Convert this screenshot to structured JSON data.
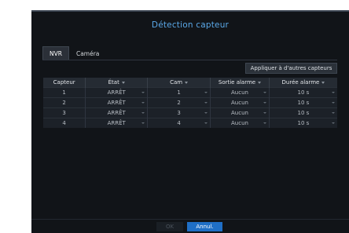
{
  "dialog": {
    "title": "Détection capteur",
    "tabs": [
      {
        "label": "NVR",
        "active": true
      },
      {
        "label": "Caméra",
        "active": false
      }
    ],
    "apply_button": "Appliquer à d'autres capteurs",
    "table": {
      "headers": [
        "Capteur",
        "État",
        "Cam",
        "Sortie alarme",
        "Durée alarme"
      ],
      "rows": [
        {
          "capteur": "1",
          "etat": "ARRÊT",
          "cam": "1",
          "sortie": "Aucun",
          "duree": "10 s"
        },
        {
          "capteur": "2",
          "etat": "ARRÊT",
          "cam": "2",
          "sortie": "Aucun",
          "duree": "10 s"
        },
        {
          "capteur": "3",
          "etat": "ARRÊT",
          "cam": "3",
          "sortie": "Aucun",
          "duree": "10 s"
        },
        {
          "capteur": "4",
          "etat": "ARRÊT",
          "cam": "4",
          "sortie": "Aucun",
          "duree": "10 s"
        }
      ]
    },
    "ok_button": "OK",
    "cancel_button": "Annul."
  },
  "colors": {
    "background": "#111418",
    "title": "#5aa8e8",
    "primary_button": "#1f6fc6"
  },
  "icons": [
    "dropdown-caret-icon"
  ]
}
